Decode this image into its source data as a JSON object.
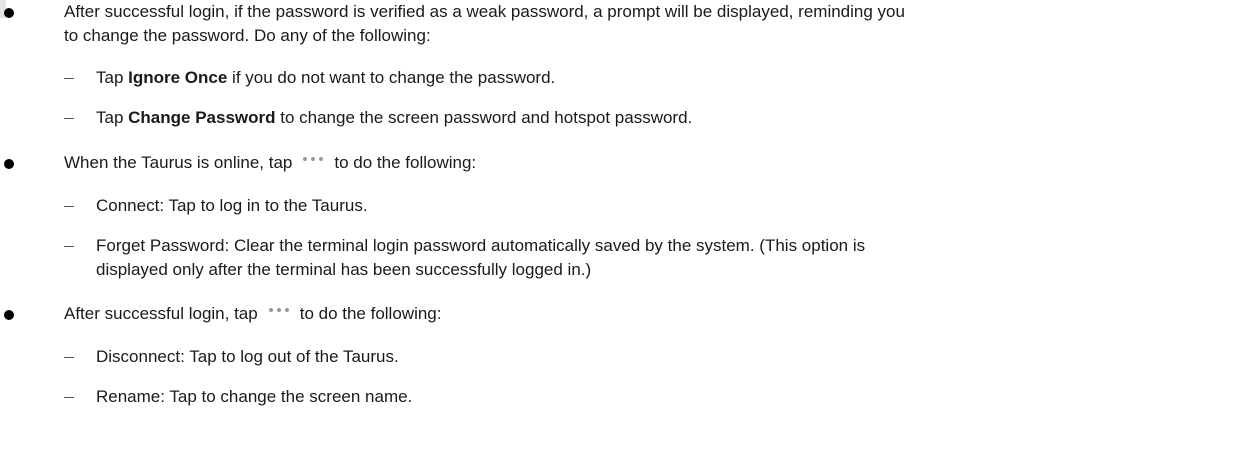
{
  "bullets": [
    {
      "line1": "After successful login, if the password is verified as a weak password, a prompt will be displayed, reminding you",
      "line2": "to change the password. Do any of the following:",
      "subs": [
        {
          "pre": "Tap ",
          "bold": "Ignore Once",
          "post": " if you do not want to change the password."
        },
        {
          "pre": "Tap ",
          "bold": "Change Password",
          "post": " to change the screen password and hotspot password."
        }
      ]
    },
    {
      "pre": "When the Taurus is online, tap",
      "post": "to do the following:",
      "icon": "more-dots-icon",
      "subs": [
        {
          "text": "Connect: Tap to log in to the Taurus."
        },
        {
          "line1": "Forget Password: Clear the terminal login password automatically saved by the system. (This option is",
          "line2": "displayed only after the terminal has been successfully logged in.)"
        }
      ]
    },
    {
      "pre": "After successful login, tap",
      "post": "to do the following:",
      "icon": "more-dots-icon",
      "subs": [
        {
          "text": "Disconnect: Tap to log out of the Taurus."
        },
        {
          "text": "Rename: Tap to change the screen name."
        }
      ]
    }
  ],
  "colors": {
    "text": "#1a1a1a",
    "icon": "#9a9a9a"
  }
}
